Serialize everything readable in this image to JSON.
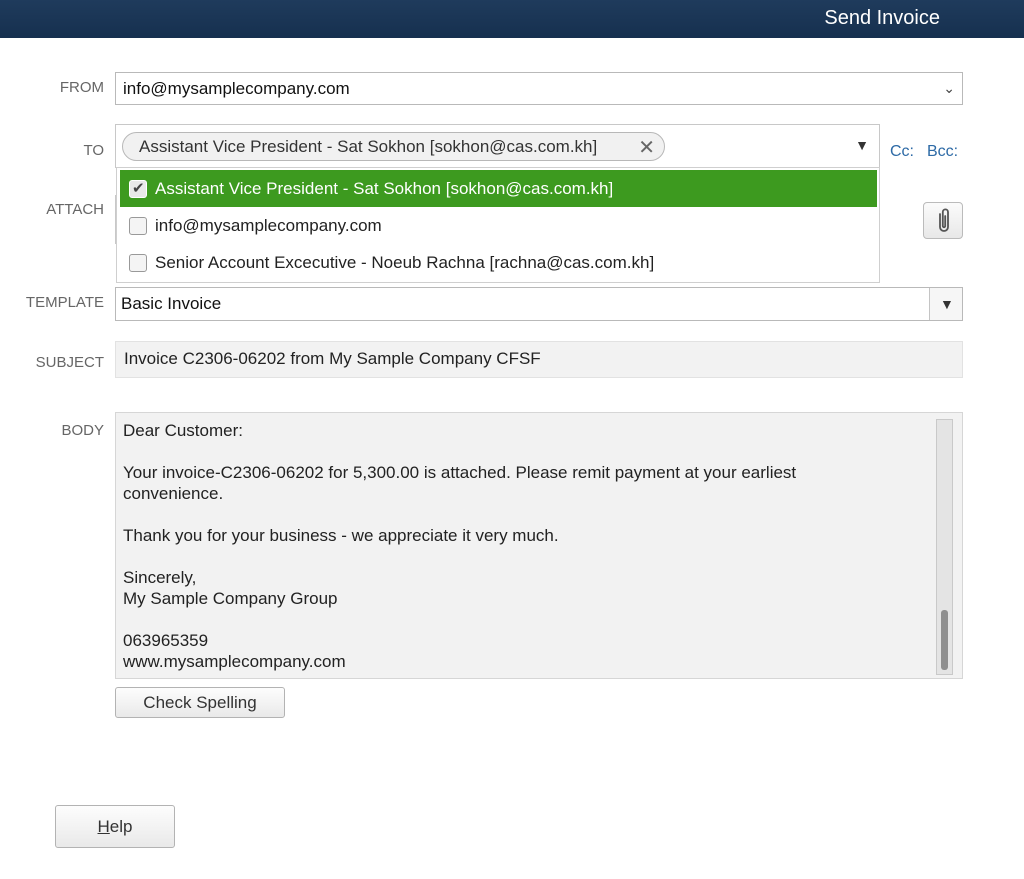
{
  "window": {
    "title": "Send Invoice"
  },
  "labels": {
    "from": "FROM",
    "to": "TO",
    "attach": "ATTACH",
    "template": "TEMPLATE",
    "subject": "SUBJECT",
    "body": "BODY"
  },
  "from": {
    "value": "info@mysamplecompany.com"
  },
  "to": {
    "chip": "Assistant Vice President - Sat Sokhon [sokhon@cas.com.kh]",
    "cc": "Cc:",
    "bcc": "Bcc:",
    "options": [
      {
        "label": "Assistant Vice President - Sat Sokhon [sokhon@cas.com.kh]",
        "checked": true
      },
      {
        "label": "info@mysamplecompany.com",
        "checked": false
      },
      {
        "label": "Senior Account Excecutive - Noeub Rachna [rachna@cas.com.kh]",
        "checked": false
      }
    ]
  },
  "template": {
    "value": "Basic Invoice"
  },
  "subject": {
    "value": "Invoice C2306-06202 from My Sample Company CFSF"
  },
  "body": {
    "line1": "Dear Customer:",
    "line2": "Your invoice-C2306-06202 for 5,300.00 is attached. Please remit payment at your earliest",
    "line3": "convenience.",
    "line4": "Thank you for your business - we appreciate it very much.",
    "line5": "Sincerely,",
    "line6": "My Sample Company Group",
    "line7": "063965359",
    "line8": "www.mysamplecompany.com"
  },
  "buttons": {
    "check_spelling": "Check Spelling",
    "help_mnemonic": "H",
    "help_rest": "elp"
  },
  "colors": {
    "titlebar": "#1f3b5c",
    "selected_option": "#3d9a1f",
    "link": "#2d6aa6"
  }
}
